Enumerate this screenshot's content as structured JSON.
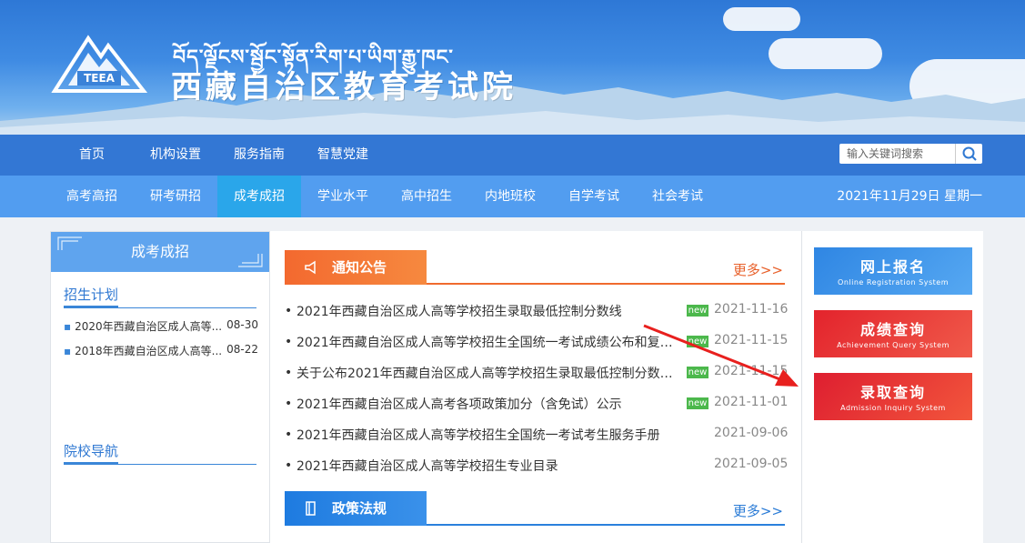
{
  "header": {
    "tibetan_title": "བོད་ལྗོངས་སྦྱོང་སྟོན་རིག་པ་ཡིག་རྒྱུ་ཁང་",
    "org_name": "西藏自治区教育考试院",
    "logo_text": "TEEA"
  },
  "nav_primary": [
    "首页",
    "机构设置",
    "服务指南",
    "智慧党建"
  ],
  "search": {
    "placeholder": "输入关键词搜索"
  },
  "nav_secondary": [
    "高考高招",
    "研考研招",
    "成考成招",
    "学业水平",
    "高中招生",
    "内地班校",
    "自学考试",
    "社会考试"
  ],
  "active_nav": "成考成招",
  "date": "2021年11月29日 星期一",
  "left_panel": {
    "title": "成考成招",
    "sections": [
      {
        "title": "招生计划",
        "items": [
          {
            "text": "2020年西藏自治区成人高等...",
            "date": "08-30"
          },
          {
            "text": "2018年西藏自治区成人高等...",
            "date": "08-22"
          }
        ]
      },
      {
        "title": "院校导航",
        "items": []
      }
    ]
  },
  "notice": {
    "title": "通知公告",
    "more": "更多>>",
    "items": [
      {
        "text": "2021年西藏自治区成人高等学校招生录取最低控制分数线",
        "new": true,
        "date": "2021-11-16"
      },
      {
        "text": "2021年西藏自治区成人高等学校招生全国统一考试成绩公布和复查...",
        "new": true,
        "date": "2021-11-15"
      },
      {
        "text": "关于公布2021年西藏自治区成人高等学校招生录取最低控制分数线...",
        "new": true,
        "date": "2021-11-15"
      },
      {
        "text": "2021年西藏自治区成人高考各项政策加分（含免试）公示",
        "new": true,
        "date": "2021-11-01"
      },
      {
        "text": "2021年西藏自治区成人高等学校招生全国统一考试考生服务手册",
        "new": false,
        "date": "2021-09-06"
      },
      {
        "text": "2021年西藏自治区成人高等学校招生专业目录",
        "new": false,
        "date": "2021-09-05"
      }
    ],
    "new_label": "new"
  },
  "policy": {
    "title": "政策法规",
    "more": "更多>>"
  },
  "right_buttons": [
    {
      "zh": "网上报名",
      "en": "Online Registration System",
      "color": "#3b8fe6"
    },
    {
      "zh": "成绩查询",
      "en": "Achievement Query System",
      "color": "#e9323a"
    },
    {
      "zh": "录取查询",
      "en": "Admission Inquiry System",
      "color": "#e4283a"
    }
  ],
  "colors": {
    "accent_orange": "#f3692f",
    "accent_blue": "#3377d4",
    "annotation_arrow": "#e8201e"
  }
}
